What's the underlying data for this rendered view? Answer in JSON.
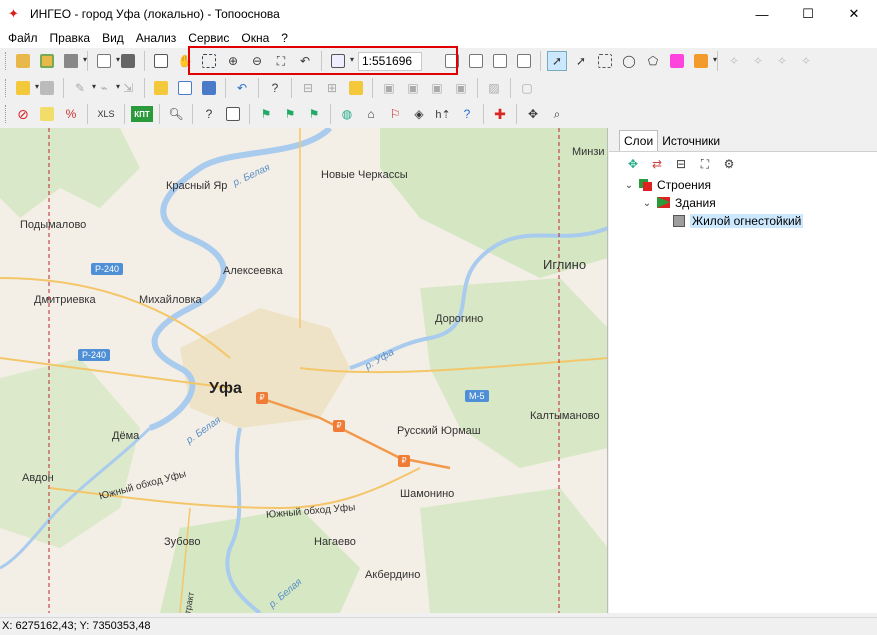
{
  "window": {
    "title": "ИНГЕО - город Уфа (локально) - Топооснова",
    "minimize": "—",
    "maximize": "☐",
    "close": "✕"
  },
  "menu": [
    "Файл",
    "Правка",
    "Вид",
    "Анализ",
    "Сервис",
    "Окна",
    "?"
  ],
  "toolbar": {
    "scale": "1:551696",
    "xls_label": "XLS",
    "kpt_label": "КПТ"
  },
  "map": {
    "labels": {
      "minzi": "Минзи",
      "krasny_yar": "Красный Яр",
      "novye_cherkassy": "Новые Черкассы",
      "podymalovo": "Подымалово",
      "iglino": "Иглино",
      "alekseevka": "Алексеевка",
      "dmitrievka": "Дмитриевка",
      "mikhaylovka": "Михайловка",
      "dorogino": "Дорогино",
      "ufa": "Уфа",
      "kaltymanovo": "Калтыманово",
      "dyoma": "Дёма",
      "russky_yurmash": "Русский Юрмаш",
      "avdon": "Авдон",
      "yuzhny_obkhod_1": "Южный обход Уфы",
      "yuzhny_obkhod_2": "Южный обход Уфы",
      "shamonino": "Шамонино",
      "zubovo": "Зубово",
      "nagaevo": "Нагаево",
      "akberdino": "Акбердино",
      "river_belaya_n": "р. Белая",
      "river_ufa": "р. Уфа",
      "river_belaya_c": "р. Белая",
      "river_belaya_s": "р. Белая",
      "trakt": "тракт"
    },
    "roads": {
      "r240_a": "Р-240",
      "r240_b": "Р-240",
      "m5": "М-5"
    },
    "toll_symbol": "₽"
  },
  "side_panel": {
    "tabs": [
      "Слои",
      "Источники"
    ],
    "active_tab": 0,
    "tree": {
      "root": "Строения",
      "child": "Здания",
      "leaf": "Жилой огнестойкий"
    }
  },
  "status": {
    "coords": "X: 6275162,43; Y: 7350353,48"
  },
  "colors": {
    "highlight_border": "#e00000",
    "selection": "#cce8ff",
    "toll": "#f07b34",
    "road_badge": "#4f8fd6"
  }
}
